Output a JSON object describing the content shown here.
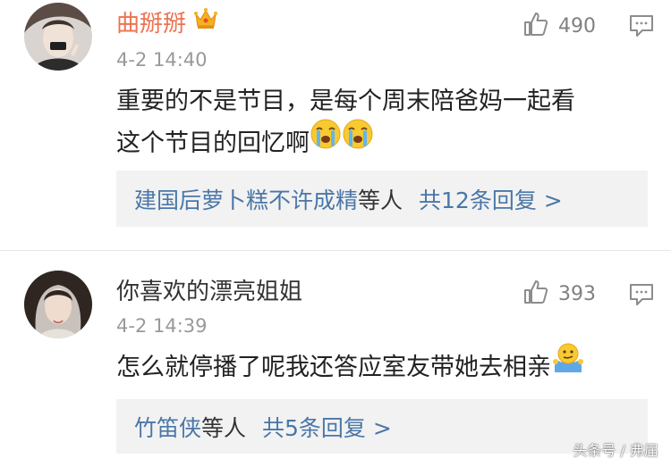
{
  "comments": [
    {
      "username": "曲掰掰",
      "badge_icon": "crown-vip-icon",
      "timestamp": "4-2 14:40",
      "likes": "490",
      "text_line1": "重要的不是节目，是每个周末陪爸妈一起看",
      "text_line2": "这个节目的回忆啊",
      "emojis": [
        "crying-face-emoji",
        "crying-face-emoji"
      ],
      "replies": {
        "users": "建国后萝卜糕不许成精",
        "suffix": "等人",
        "count_text": "共12条回复 >"
      }
    },
    {
      "username": "你喜欢的漂亮姐姐",
      "timestamp": "4-2 14:39",
      "likes": "393",
      "text": "怎么就停播了呢我还答应室友带她去相亲",
      "emojis": [
        "shrug-emoji"
      ],
      "replies": {
        "users": "竹笛侠",
        "suffix": "等人",
        "count_text": "共5条回复 >"
      }
    }
  ],
  "watermark": "头条号 / 弗届",
  "colors": {
    "vip_username": "#eb7350",
    "link": "#4a77a8",
    "timestamp": "#999999",
    "reply_box_bg": "#f2f2f2"
  }
}
